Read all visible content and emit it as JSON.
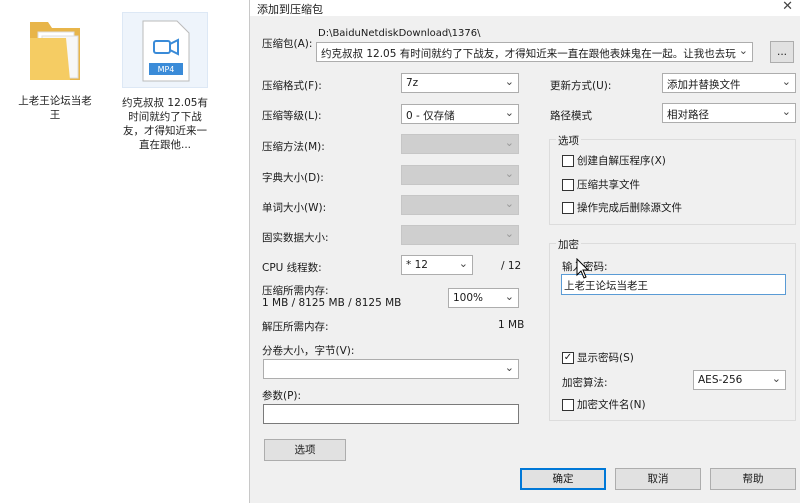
{
  "desktop": {
    "folder_label": "上老王论坛当老王",
    "video_label": "约克叔叔 12.05有时间就约了下战友，才得知近来一直在跟他...",
    "video_badge": "MP4"
  },
  "dialog": {
    "title": "添加到压缩包",
    "archive": {
      "label": "压缩包(A):",
      "path": "D:\\BaiduNetdiskDownload\\1376\\",
      "filename": "约克叔叔 12.05 有时间就约了下战友，才得知近来一直在跟他表妹鬼在一起。让我也去玩:",
      "browse_label": "..."
    },
    "format": {
      "label": "压缩格式(F):",
      "value": "7z"
    },
    "level": {
      "label": "压缩等级(L):",
      "value": "0 - 仅存储"
    },
    "method": {
      "label": "压缩方法(M):"
    },
    "dict": {
      "label": "字典大小(D):"
    },
    "word": {
      "label": "单词大小(W):"
    },
    "solid": {
      "label": "固实数据大小:"
    },
    "cpu": {
      "label": "CPU 线程数:",
      "value": "* 12",
      "total": "/ 12"
    },
    "mem_compress": {
      "label": "压缩所需内存:",
      "detail": "1 MB / 8125 MB / 8125 MB",
      "percent": "100%"
    },
    "mem_decompress": {
      "label": "解压所需内存:",
      "value": "1 MB"
    },
    "split": {
      "label": "分卷大小，字节(V):",
      "value": ""
    },
    "params": {
      "label": "参数(P):",
      "value": ""
    },
    "options_button": "选项",
    "update_mode": {
      "label": "更新方式(U):",
      "value": "添加并替换文件"
    },
    "path_mode": {
      "label": "路径模式",
      "value": "相对路径"
    },
    "options_group": {
      "title": "选项",
      "sfx": "创建自解压程序(X)",
      "shared": "压缩共享文件",
      "delete_after": "操作完成后删除源文件"
    },
    "encryption": {
      "title": "加密",
      "password_label": "输入密码:",
      "password_value": "上老王论坛当老王",
      "show_password": "显示密码(S)",
      "method_label": "加密算法:",
      "method_value": "AES-256",
      "encrypt_names": "加密文件名(N)"
    },
    "buttons": {
      "ok": "确定",
      "cancel": "取消",
      "help": "帮助"
    }
  }
}
